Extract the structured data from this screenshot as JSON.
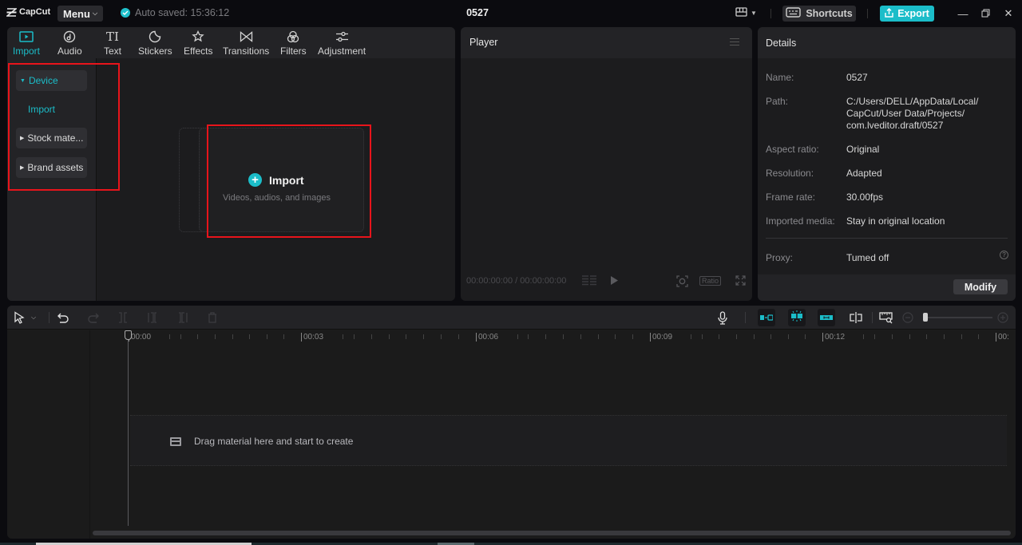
{
  "titlebar": {
    "app_name": "CapCut",
    "menu_label": "Menu",
    "autosave_text": "Auto saved: 15:36:12",
    "project_title": "0527",
    "shortcuts_label": "Shortcuts",
    "export_label": "Export",
    "accent_color": "#1bbdc9"
  },
  "media_panel": {
    "tabs": [
      {
        "label": "Import",
        "icon": "import-icon",
        "active": true
      },
      {
        "label": "Audio",
        "icon": "audio-icon"
      },
      {
        "label": "Text",
        "icon": "text-icon"
      },
      {
        "label": "Stickers",
        "icon": "stickers-icon"
      },
      {
        "label": "Effects",
        "icon": "effects-icon"
      },
      {
        "label": "Transitions",
        "icon": "transitions-icon"
      },
      {
        "label": "Filters",
        "icon": "filters-icon"
      },
      {
        "label": "Adjustment",
        "icon": "adjustment-icon"
      }
    ],
    "sidebar": {
      "device_label": "Device",
      "device_sub_label": "Import",
      "stock_label": "Stock mate...",
      "brand_label": "Brand assets"
    },
    "import_card": {
      "title": "Import",
      "subtitle": "Videos, audios, and images"
    }
  },
  "player": {
    "title": "Player",
    "timecode": "00:00:00:00 / 00:00:00:00",
    "ratio_label": "Ratio"
  },
  "details": {
    "title": "Details",
    "rows": [
      {
        "key": "Name:",
        "value": "0527"
      },
      {
        "key": "Path:",
        "value": "C:/Users/DELL/AppData/Local/ CapCut/User Data/Projects/ com.lveditor.draft/0527"
      },
      {
        "key": "Aspect ratio:",
        "value": "Original"
      },
      {
        "key": "Resolution:",
        "value": "Adapted"
      },
      {
        "key": "Frame rate:",
        "value": "30.00fps"
      },
      {
        "key": "Imported media:",
        "value": "Stay in original location"
      },
      {
        "key": "Proxy:",
        "value": "Tumed off"
      }
    ],
    "modify_label": "Modify"
  },
  "timeline": {
    "ruler_labels": [
      "00:00",
      "00:03",
      "00:06",
      "00:09",
      "00:12",
      "00:"
    ],
    "drop_text": "Drag material here and start to create",
    "zoom_level_fraction": 0.05
  }
}
